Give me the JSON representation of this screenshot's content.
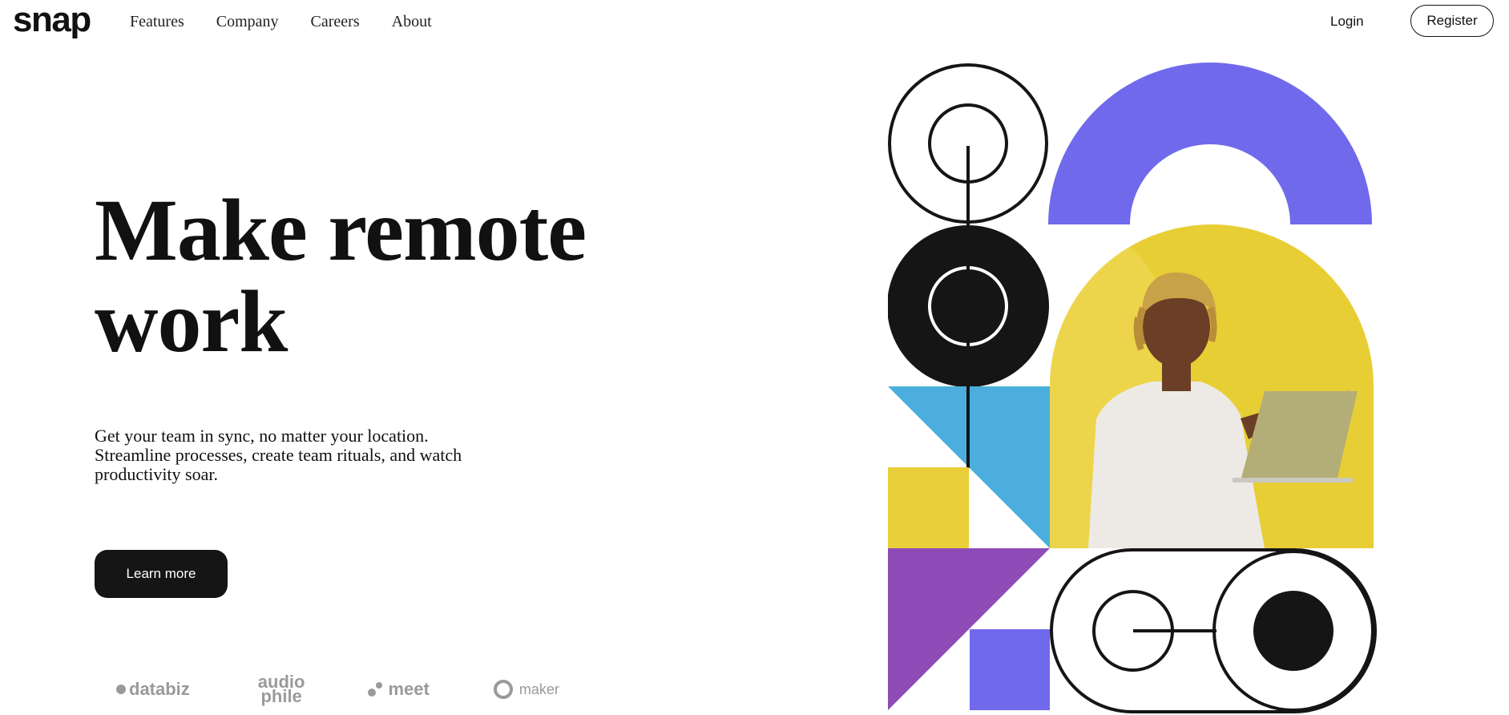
{
  "header": {
    "logo": "snap",
    "nav": [
      "Features",
      "Company",
      "Careers",
      "About"
    ],
    "login": "Login",
    "register": "Register"
  },
  "hero": {
    "title_line1": "Make remote",
    "title_line2": "work",
    "subtitle": "Get your team in sync, no matter your location. Streamline processes, create team rituals, and watch productivity soar.",
    "cta": "Learn more"
  },
  "clients": {
    "databiz": "databiz",
    "audiophile_line1": "audio",
    "audiophile_line2": "phile",
    "meet": "meet",
    "maker": "maker"
  },
  "colors": {
    "purple": "#7069EC",
    "yellow": "#E9CF3A",
    "blue": "#4BAEDC",
    "violet": "#8E4BB8",
    "dark": "#151515"
  },
  "hero_image": {
    "icon": "person-with-laptop-photo"
  }
}
